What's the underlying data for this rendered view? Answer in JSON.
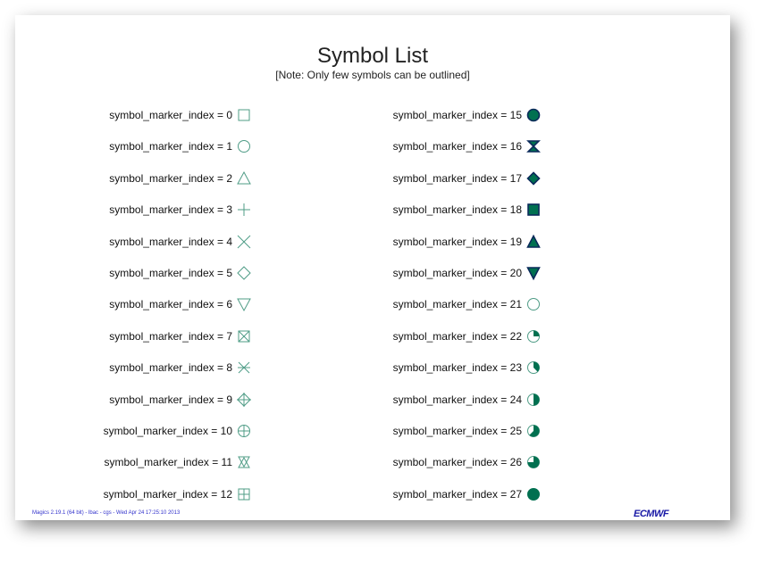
{
  "title": "Symbol List",
  "subtitle": "[Note: Only few symbols can be outlined]",
  "colors": {
    "fill": "#007050",
    "outline": "#0a2a5a",
    "line": "#4f9c86"
  },
  "left_column": [
    {
      "label": "symbol_marker_index = 0",
      "marker": 0
    },
    {
      "label": "symbol_marker_index = 1",
      "marker": 1
    },
    {
      "label": "symbol_marker_index = 2",
      "marker": 2
    },
    {
      "label": "symbol_marker_index = 3",
      "marker": 3
    },
    {
      "label": "symbol_marker_index = 4",
      "marker": 4
    },
    {
      "label": "symbol_marker_index = 5",
      "marker": 5
    },
    {
      "label": "symbol_marker_index = 6",
      "marker": 6
    },
    {
      "label": "symbol_marker_index = 7",
      "marker": 7
    },
    {
      "label": "symbol_marker_index = 8",
      "marker": 8
    },
    {
      "label": "symbol_marker_index = 9",
      "marker": 9
    },
    {
      "label": "symbol_marker_index = 10",
      "marker": 10
    },
    {
      "label": "symbol_marker_index = 11",
      "marker": 11
    },
    {
      "label": "symbol_marker_index = 12",
      "marker": 12
    }
  ],
  "right_column": [
    {
      "label": "symbol_marker_index = 15",
      "marker": 15
    },
    {
      "label": "symbol_marker_index = 16",
      "marker": 16
    },
    {
      "label": "symbol_marker_index = 17",
      "marker": 17
    },
    {
      "label": "symbol_marker_index = 18",
      "marker": 18
    },
    {
      "label": "symbol_marker_index = 19",
      "marker": 19
    },
    {
      "label": "symbol_marker_index = 20",
      "marker": 20
    },
    {
      "label": "symbol_marker_index = 21",
      "marker": 21
    },
    {
      "label": "symbol_marker_index = 22",
      "marker": 22
    },
    {
      "label": "symbol_marker_index = 23",
      "marker": 23
    },
    {
      "label": "symbol_marker_index = 24",
      "marker": 24
    },
    {
      "label": "symbol_marker_index = 25",
      "marker": 25
    },
    {
      "label": "symbol_marker_index = 26",
      "marker": 26
    },
    {
      "label": "symbol_marker_index = 27",
      "marker": 27
    }
  ],
  "footer_text": "Magics 2.19.1 (64 bit) - lbac - cgs - Wed Apr 24 17:25:10 2013",
  "logo_text": "ECMWF"
}
